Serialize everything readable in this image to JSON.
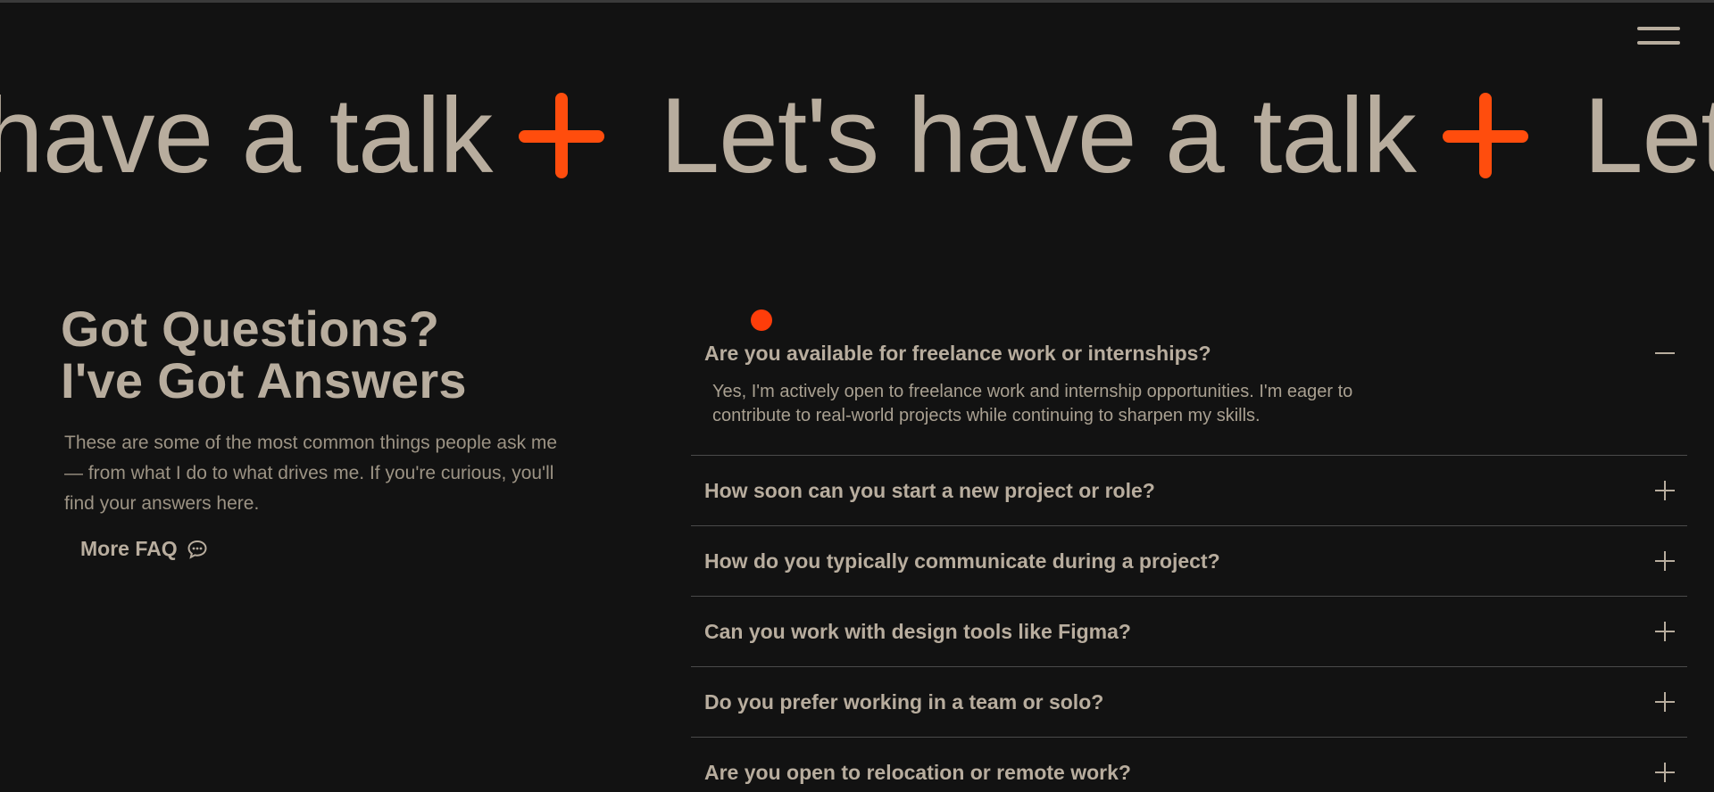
{
  "nav": {
    "menu_icon": "hamburger-menu-icon"
  },
  "marquee": {
    "text": "Let's have a talk",
    "leading_fragment": "have a talk",
    "trailing_fragment": "Let'",
    "separator_icon": "plus-icon",
    "accent_color": "#ff4d0d"
  },
  "faq": {
    "title_line1": "Got Questions?",
    "title_line2": "I've Got Answers",
    "description": "These are some of the most common things people ask me — from what I do to what drives me. If you're curious, you'll find your answers here.",
    "more_label": "More FAQ",
    "more_icon": "chat-bubble-icon",
    "items": [
      {
        "question": "Are you available for freelance work or internships?",
        "answer": "Yes, I'm actively open to freelance work and internship opportunities. I'm eager to contribute to real-world projects while continuing to sharpen my skills.",
        "open": true
      },
      {
        "question": "How soon can you start a new project or role?",
        "open": false
      },
      {
        "question": "How do you typically communicate during a project?",
        "open": false
      },
      {
        "question": "Can you work with design tools like Figma?",
        "open": false
      },
      {
        "question": "Do you prefer working in a team or solo?",
        "open": false
      },
      {
        "question": "Are you open to relocation or remote work?",
        "open": false
      }
    ]
  },
  "colors": {
    "background": "#121212",
    "text": "#b8ad9e",
    "accent": "#ff4d0d",
    "divider": "#4a4a4a"
  }
}
